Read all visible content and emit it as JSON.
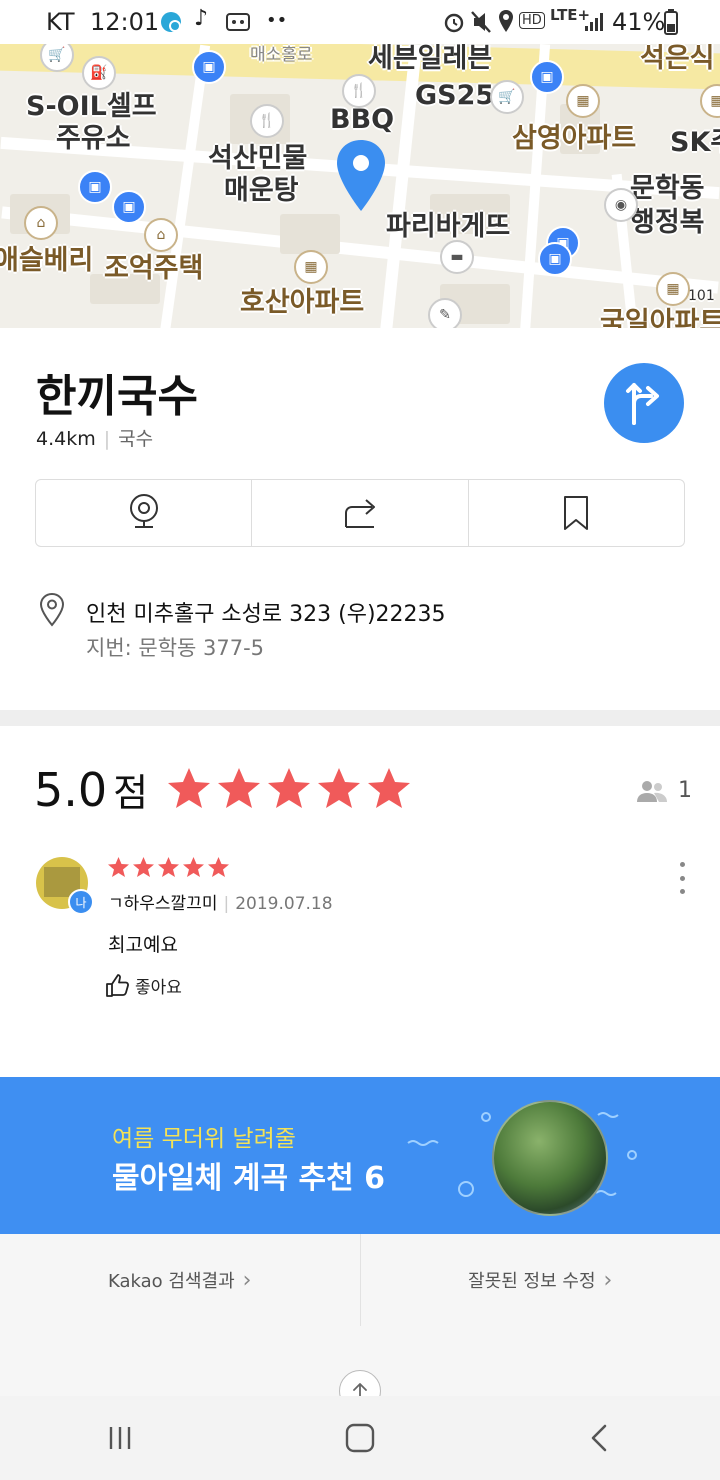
{
  "status_bar": {
    "carrier": "KT",
    "time": "12:01",
    "dots": "••",
    "network": "LTE+",
    "battery": "41%"
  },
  "map": {
    "labels": {
      "top_road": "매소홀로",
      "seven_eleven": "세븐일레븐",
      "top_right": "석은식",
      "gas_station_1": "S-OIL셀프",
      "gas_station_2": "주유소",
      "gs25": "GS25",
      "bbq": "BBQ",
      "apartment_sam": "삼영아파트",
      "sk": "SK주",
      "restaurant_1": "석산민물",
      "restaurant_2": "매운탕",
      "district_1": "문학동",
      "district_2": "행정복",
      "bakery": "파리바게뜨",
      "left_shop": "애슬베리",
      "house": "조억주택",
      "apartment_hosan": "호산아파트",
      "apartment_gukil": "국일아파트",
      "building_num": "101"
    },
    "pin_color": "#3b8ef0"
  },
  "place": {
    "name": "한끼국수",
    "distance": "4.4km",
    "category": "국수"
  },
  "actions": [
    "roadview-icon",
    "share-icon",
    "bookmark-icon"
  ],
  "address": {
    "main": "인천 미추홀구 소성로 323 (우)22235",
    "lot": "지번: 문학동 377-5"
  },
  "rating": {
    "score": "5.0",
    "unit": "점",
    "stars": 5,
    "reviewer_count": "1",
    "star_color": "#f05a5a"
  },
  "review": {
    "badge": "나",
    "author": "ㄱ하우스깔끄미",
    "date": "2019.07.18",
    "stars": 5,
    "text": "최고예요",
    "like_label": "좋아요"
  },
  "banner": {
    "subtitle": "여름 무더위 날려줄",
    "title": "물아일체 계곡 추천 6",
    "bg_color": "#3f8ff2"
  },
  "footer": {
    "kakao_link": "Kakao 검색결과",
    "report_link": "잘못된 정보 수정",
    "chevron": "›"
  }
}
